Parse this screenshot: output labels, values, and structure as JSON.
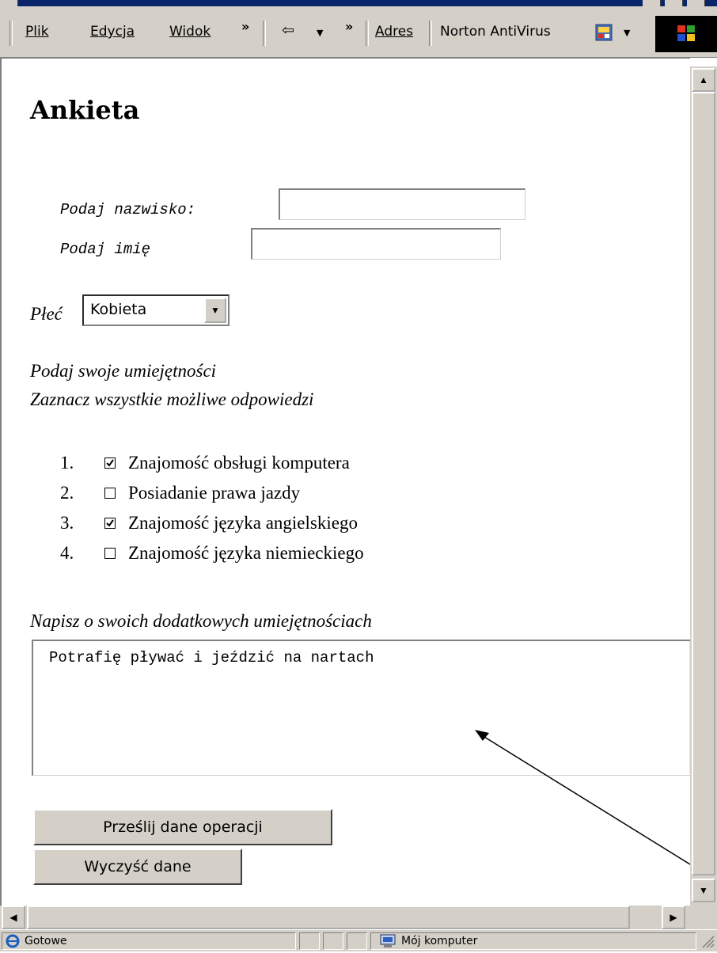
{
  "menu": {
    "file": "Plik",
    "edit": "Edycja",
    "view": "Widok",
    "overflow": "»",
    "address": "Adres",
    "antivirus": "Norton AntiVirus"
  },
  "page": {
    "title": "Ankieta",
    "surname_label": "Podaj nazwisko:",
    "surname_value": "",
    "name_label": "Podaj imię",
    "name_value": "",
    "gender_label": "Płeć",
    "gender_selected": "Kobieta",
    "skills_prompt": "Podaj swoje umiejętności",
    "skills_hint": "Zaznacz wszystkie możliwe odpowiedzi",
    "skills": [
      {
        "num": "1.",
        "label": "Znajomość obsługi komputera",
        "checked": true
      },
      {
        "num": "2.",
        "label": "Posiadanie prawa jazdy",
        "checked": false
      },
      {
        "num": "3.",
        "label": "Znajomość języka angielskiego",
        "checked": true
      },
      {
        "num": "4.",
        "label": "Znajomość języka niemieckiego",
        "checked": false
      }
    ],
    "extra_label": "Napisz o swoich dodatkowych umiejętnościach",
    "extra_value": "Potrafię pływać i jeździć na nartach",
    "submit_label": "Prześlij dane operacji",
    "reset_label": "Wyczyść dane"
  },
  "status": {
    "text": "Gotowe",
    "zone": "Mój komputer"
  },
  "colors": {
    "chrome": "#d4d0c8",
    "titlebar": "#0a246a"
  }
}
